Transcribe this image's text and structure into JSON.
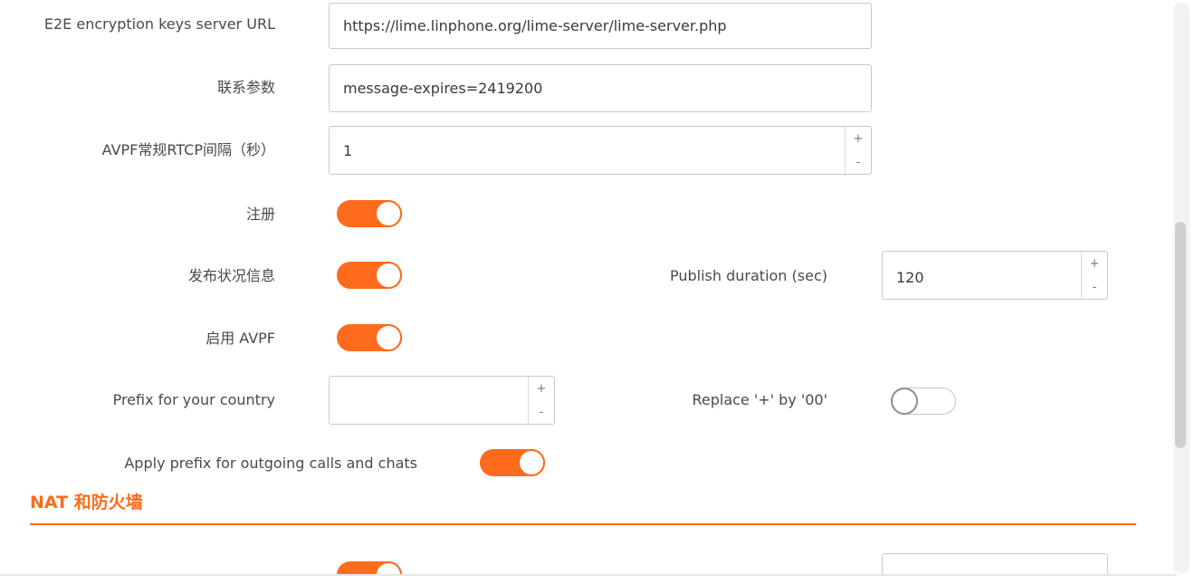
{
  "settings": {
    "lime_url": {
      "label": "E2E encryption keys server URL",
      "value": "https://lime.linphone.org/lime-server/lime-server.php"
    },
    "contact_params": {
      "label": "联系参数",
      "value": "message-expires=2419200"
    },
    "avpf_interval": {
      "label": "AVPF常规RTCP间隔（秒）",
      "value": "1",
      "up": "+",
      "down": "-"
    },
    "register": {
      "label": "注册",
      "state": "on"
    },
    "publish": {
      "label": "发布状况信息",
      "state": "on"
    },
    "publish_duration": {
      "label": "Publish duration (sec)",
      "value": "120",
      "up": "+",
      "down": "-"
    },
    "avpf": {
      "label": "启用 AVPF",
      "state": "on"
    },
    "country_prefix": {
      "label": "Prefix for your country",
      "value": "",
      "up": "+",
      "down": "-"
    },
    "replace_plus": {
      "label": "Replace '+' by '00'",
      "state": "off"
    },
    "apply_prefix": {
      "label": "Apply prefix for outgoing calls and chats",
      "state": "on"
    }
  },
  "section": {
    "title": "NAT 和防火墙"
  },
  "colors": {
    "accent": "#fe6b1c",
    "border": "#c9c9c9",
    "text": "#4a4a4a"
  }
}
